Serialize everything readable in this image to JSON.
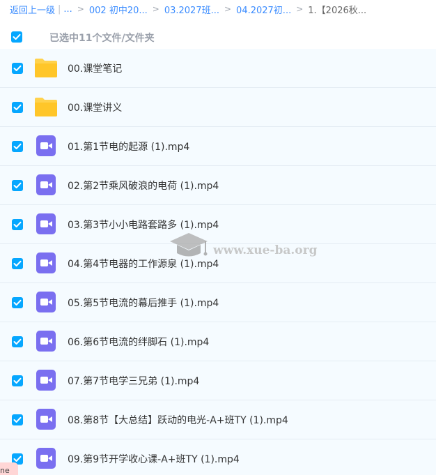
{
  "breadcrumb": {
    "back_label": "返回上一级",
    "separator_bar": "|",
    "items": [
      {
        "label": "..."
      },
      {
        "label": "002 初中20..."
      },
      {
        "label": "03.2027班..."
      },
      {
        "label": "04.2027初..."
      },
      {
        "label": "1.【2026秋..."
      }
    ],
    "chevron": ">"
  },
  "selection": {
    "label": "已选中11个文件/文件夹",
    "checked": true
  },
  "files": [
    {
      "name": "00.课堂笔记",
      "type": "folder",
      "checked": true
    },
    {
      "name": "00.课堂讲义",
      "type": "folder",
      "checked": true
    },
    {
      "name": "01.第1节电的起源 (1).mp4",
      "type": "video",
      "checked": true
    },
    {
      "name": "02.第2节乘风破浪的电荷 (1).mp4",
      "type": "video",
      "checked": true
    },
    {
      "name": "03.第3节小小电路套路多 (1).mp4",
      "type": "video",
      "checked": true
    },
    {
      "name": "04.第4节电器的工作源泉 (1).mp4",
      "type": "video",
      "checked": true
    },
    {
      "name": "05.第5节电流的幕后推手 (1).mp4",
      "type": "video",
      "checked": true
    },
    {
      "name": "06.第6节电流的绊脚石 (1).mp4",
      "type": "video",
      "checked": true
    },
    {
      "name": "07.第7节电学三兄弟 (1).mp4",
      "type": "video",
      "checked": true
    },
    {
      "name": "08.第8节【大总结】跃动的电光-A+班TY (1).mp4",
      "type": "video",
      "checked": true
    },
    {
      "name": "09.第9节开学收心课-A+班TY (1).mp4",
      "type": "video",
      "checked": true
    }
  ],
  "watermark": {
    "text": "www.xue-ba.org",
    "icon": "graduation-cap-icon"
  },
  "corner_badge": {
    "text": "ne"
  },
  "colors": {
    "accent": "#06a7ff",
    "link": "#3b8cff",
    "folder": "#ffc93c",
    "video": "#7a6ff0",
    "row_bg": "#f5fbff"
  }
}
